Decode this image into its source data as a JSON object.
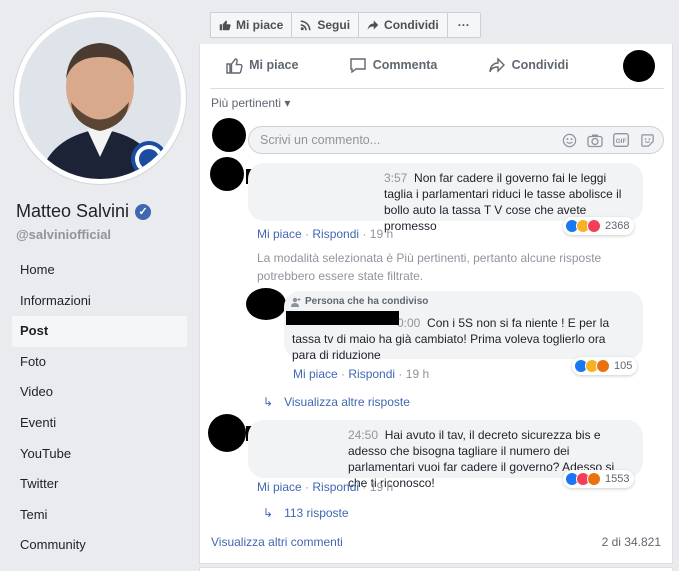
{
  "page": {
    "name": "Matteo Salvini",
    "handle": "@salviniofficial"
  },
  "nav": {
    "items": [
      "Home",
      "Informazioni",
      "Post",
      "Foto",
      "Video",
      "Eventi",
      "YouTube",
      "Twitter",
      "Temi",
      "Community"
    ],
    "active": "Post"
  },
  "top_bar": {
    "like": "Mi piace",
    "follow": "Segui",
    "share": "Condividi",
    "more": "···"
  },
  "post_actions": {
    "like": "Mi piace",
    "comment": "Commenta",
    "share": "Condividi"
  },
  "comments_section": {
    "sort_label": "Più pertinenti",
    "composer_placeholder": "Scrivi un commento...",
    "filter_notice": "La modalità selezionata è Più pertinenti, pertanto alcune risposte potrebbero essere state filtrate.",
    "view_more_comments": "Visualizza altri commenti",
    "count_label": "2 di 34.821"
  },
  "comments": [
    {
      "time": "3:57",
      "text": "Non far cadere il governo fai le leggi taglia i parlamentari riduci le tasse abolisce il bollo auto la tassa T V cose che avete promesso",
      "like": "Mi piace",
      "reply": "Rispondi",
      "age": "19 h",
      "reactions": "2368"
    },
    {
      "shared_tag": "Persona che ha condiviso",
      "time": "0:00",
      "text": "Con i 5S non si fa niente ! E per la tassa tv di maio ha già cambiato! Prima voleva toglierlo ora para di riduzione",
      "like": "Mi piace",
      "reply": "Rispondi",
      "age": "19 h",
      "reactions": "105"
    },
    {
      "time": "24:50",
      "text": "Hai avuto il tav, il decreto sicurezza bis e adesso che bisogna tagliare il numero dei parlamentari vuoi far cadere il governo? Adesso si che ti riconosco!",
      "like": "Mi piace",
      "reply": "Rispondi",
      "age": "19 h",
      "reactions": "1553"
    }
  ],
  "replies_links": {
    "first": "Visualizza altre risposte",
    "second": "113 risposte"
  },
  "icons": {
    "like": "thumbs-up-icon",
    "comment": "comment-icon",
    "share": "share-arrow-icon",
    "follow": "rss-icon",
    "emoji": "emoji-icon",
    "camera": "camera-icon",
    "gif": "gif-icon",
    "sticker": "sticker-icon",
    "reply_arrow": "reply-arrow-icon",
    "verified": "verified-badge-icon"
  },
  "colors": {
    "link": "#4267b2",
    "muted": "#90949c",
    "like_reaction": "#1877f2",
    "haha_reaction": "#f7b125",
    "love_reaction": "#f33e58",
    "angry_reaction": "#e9710f"
  }
}
